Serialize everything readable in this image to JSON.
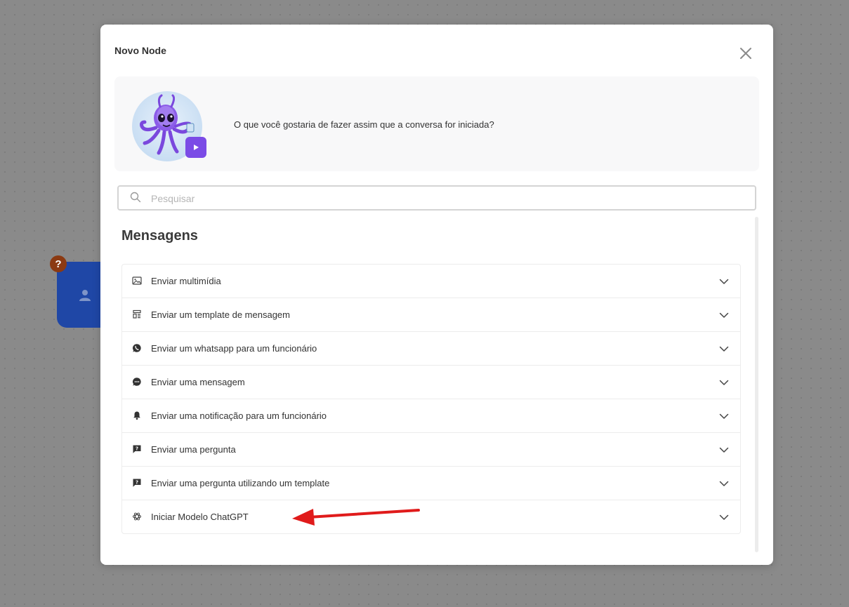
{
  "modal": {
    "title": "Novo Node",
    "intro_text": "O que você gostaria de fazer assim que a conversa for iniciada?",
    "search": {
      "placeholder": "Pesquisar",
      "value": ""
    },
    "section_title": "Mensagens",
    "items": [
      {
        "label": "Enviar multimídia",
        "icon": "image-icon"
      },
      {
        "label": "Enviar um template de mensagem",
        "icon": "template-icon"
      },
      {
        "label": "Enviar um whatsapp para um funcionário",
        "icon": "whatsapp-icon"
      },
      {
        "label": "Enviar uma mensagem",
        "icon": "message-icon"
      },
      {
        "label": "Enviar uma notificação para um funcionário",
        "icon": "bell-icon"
      },
      {
        "label": "Enviar uma pergunta",
        "icon": "question-icon"
      },
      {
        "label": "Enviar uma pergunta utilizando um template",
        "icon": "question-icon"
      },
      {
        "label": "Iniciar Modelo ChatGPT",
        "icon": "chatgpt-icon"
      }
    ]
  },
  "background": {
    "help_badge": "?"
  },
  "colors": {
    "accent": "#7b4be6",
    "node_blue": "#1f47a6",
    "annotation_arrow": "#e01b1b"
  }
}
